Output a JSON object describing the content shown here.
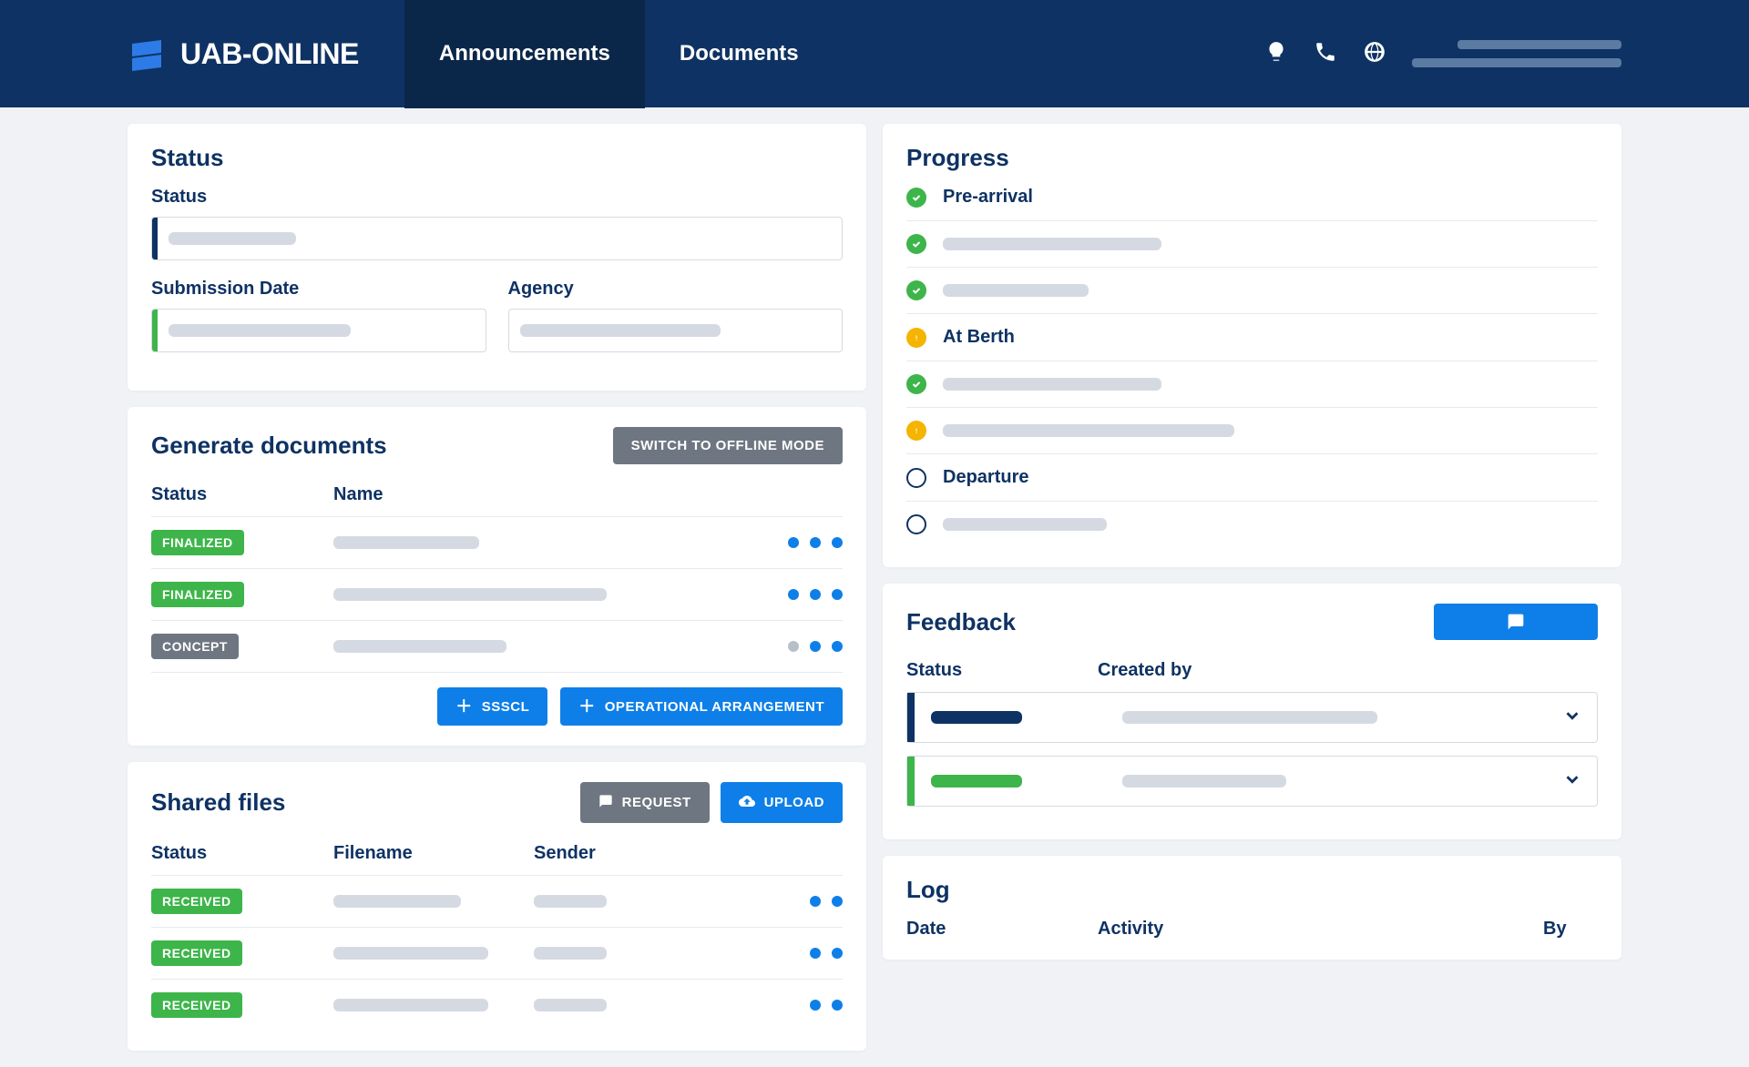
{
  "brand": {
    "name": "UAB-ONLINE"
  },
  "nav": {
    "announcements": "Announcements",
    "documents": "Documents"
  },
  "status_card": {
    "title": "Status",
    "status_label": "Status",
    "submission_label": "Submission Date",
    "agency_label": "Agency"
  },
  "generate": {
    "title": "Generate documents",
    "switch_btn": "SWITCH TO OFFLINE MODE",
    "cols": {
      "status": "Status",
      "name": "Name"
    },
    "rows": [
      {
        "badge": "FINALIZED",
        "badge_class": "finalized",
        "dots_gray": false
      },
      {
        "badge": "FINALIZED",
        "badge_class": "finalized",
        "dots_gray": false
      },
      {
        "badge": "CONCEPT",
        "badge_class": "concept",
        "dots_gray": true
      }
    ],
    "ssscl_btn": "SSSCL",
    "op_btn": "OPERATIONAL ARRANGEMENT"
  },
  "shared": {
    "title": "Shared files",
    "request_btn": "REQUEST",
    "upload_btn": "UPLOAD",
    "cols": {
      "status": "Status",
      "filename": "Filename",
      "sender": "Sender"
    },
    "rows": [
      {
        "badge": "RECEIVED"
      },
      {
        "badge": "RECEIVED"
      },
      {
        "badge": "RECEIVED"
      }
    ]
  },
  "progress": {
    "title": "Progress",
    "items": [
      {
        "state": "ok",
        "label": "Pre-arrival"
      },
      {
        "state": "ok",
        "label": ""
      },
      {
        "state": "ok",
        "label": ""
      },
      {
        "state": "warn",
        "label": "At Berth"
      },
      {
        "state": "ok",
        "label": ""
      },
      {
        "state": "warn",
        "label": ""
      },
      {
        "state": "empty",
        "label": "Departure"
      },
      {
        "state": "empty",
        "label": ""
      }
    ]
  },
  "feedback": {
    "title": "Feedback",
    "cols": {
      "status": "Status",
      "created_by": "Created by"
    }
  },
  "log": {
    "title": "Log",
    "cols": {
      "date": "Date",
      "activity": "Activity",
      "by": "By"
    }
  }
}
